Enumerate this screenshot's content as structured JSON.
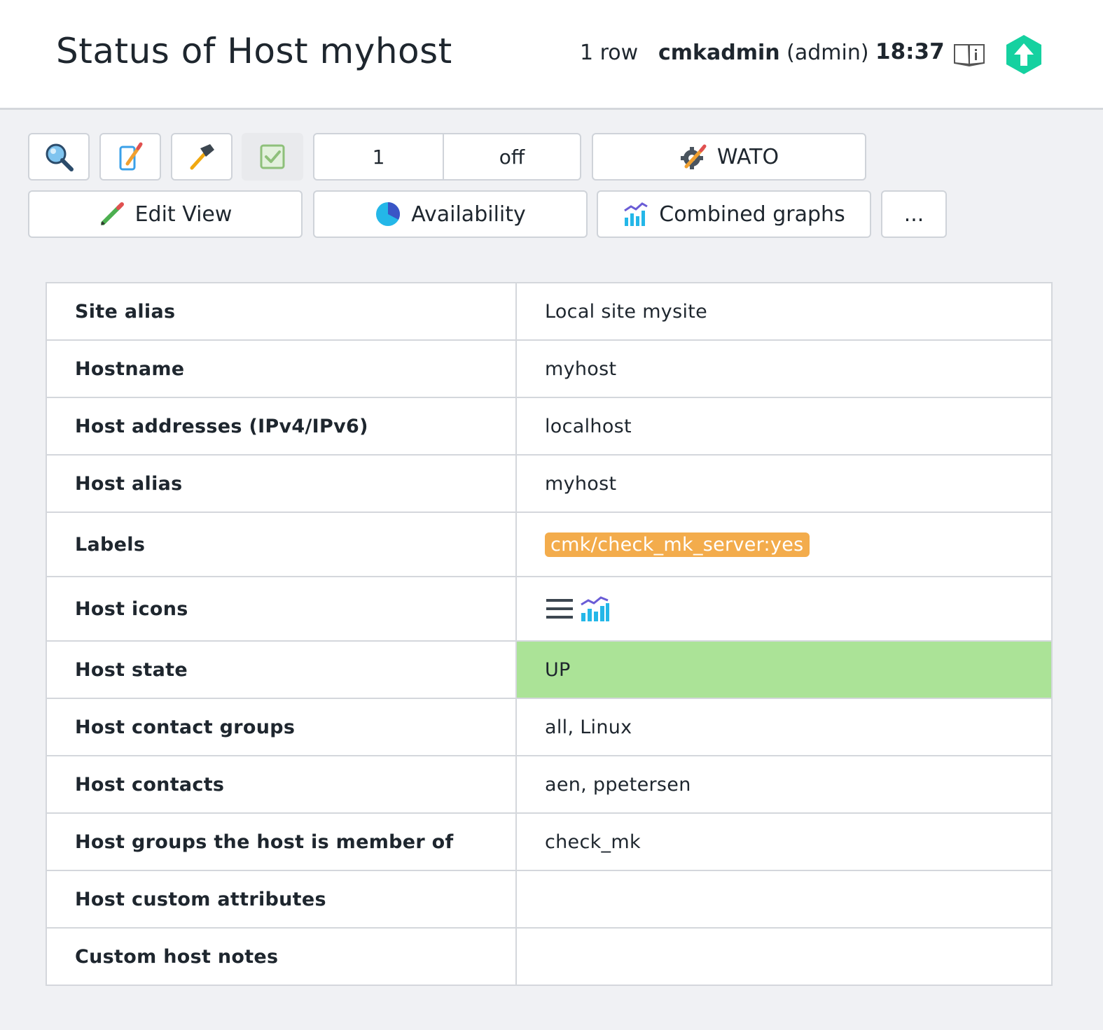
{
  "header": {
    "title": "Status of Host myhost",
    "row_count": "1 row",
    "user_name": "cmkadmin",
    "user_role": "(admin)",
    "time": "18:37",
    "book_icon": "manual-book-icon",
    "logo_icon": "checkmk-logo-icon"
  },
  "toolbar": {
    "filter_icon": "search-icon",
    "edit_icon": "edit-columns-icon",
    "commands_icon": "hammer-icon",
    "checkbox_icon": "checkbox-icon",
    "refresh_value": "1",
    "refresh_state": "off",
    "wato_label": "WATO",
    "edit_view_label": "Edit View",
    "availability_label": "Availability",
    "combined_graphs_label": "Combined graphs",
    "more_label": "..."
  },
  "table": {
    "rows": [
      {
        "key": "Site alias",
        "value": "Local site mysite"
      },
      {
        "key": "Hostname",
        "value": "myhost"
      },
      {
        "key": "Host addresses (IPv4/IPv6)",
        "value": "localhost"
      },
      {
        "key": "Host alias",
        "value": "myhost"
      },
      {
        "key": "Labels",
        "value": "cmk/check_mk_server:yes"
      },
      {
        "key": "Host icons",
        "value": ""
      },
      {
        "key": "Host state",
        "value": "UP"
      },
      {
        "key": "Host contact groups",
        "value": "all, Linux"
      },
      {
        "key": "Host contacts",
        "value": "aen, ppetersen"
      },
      {
        "key": "Host groups the host is member of",
        "value": "check_mk"
      },
      {
        "key": "Host custom attributes",
        "value": ""
      },
      {
        "key": "Custom host notes",
        "value": ""
      }
    ]
  },
  "colors": {
    "state_up": "#abe397",
    "label_pill": "#f3ac4c",
    "logo": "#15d1a0"
  }
}
